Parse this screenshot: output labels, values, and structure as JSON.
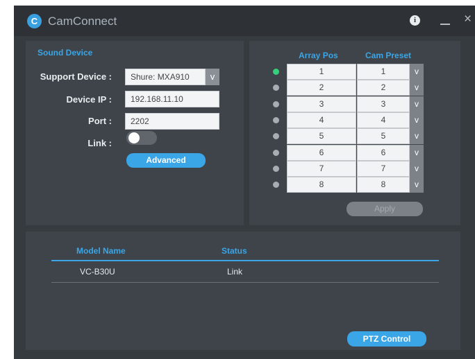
{
  "app": {
    "title": "CamConnect",
    "logo_letter": "C"
  },
  "window_controls": {
    "info": "i",
    "minimize": "",
    "close": "×"
  },
  "sound_device": {
    "section_title": "Sound Device",
    "support_device_label": "Support Device :",
    "support_device_value": "Shure: MXA910",
    "device_ip_label": "Device IP :",
    "device_ip_value": "192.168.11.10",
    "port_label": "Port :",
    "port_value": "2202",
    "link_label": "Link :",
    "link_on": false,
    "advanced_button": "Advanced"
  },
  "mapping": {
    "array_pos_header": "Array Pos",
    "cam_preset_header": "Cam Preset",
    "rows": [
      {
        "array_pos": "1",
        "cam_preset": "1",
        "active": true
      },
      {
        "array_pos": "2",
        "cam_preset": "2",
        "active": false
      },
      {
        "array_pos": "3",
        "cam_preset": "3",
        "active": false
      },
      {
        "array_pos": "4",
        "cam_preset": "4",
        "active": false
      },
      {
        "array_pos": "5",
        "cam_preset": "5",
        "active": false
      },
      {
        "array_pos": "6",
        "cam_preset": "6",
        "active": false
      },
      {
        "array_pos": "7",
        "cam_preset": "7",
        "active": false
      },
      {
        "array_pos": "8",
        "cam_preset": "8",
        "active": false
      }
    ],
    "apply_button": "Apply",
    "dropdown_glyph": "v"
  },
  "camera_table": {
    "headers": {
      "model_name": "Model Name",
      "status": "Status"
    },
    "rows": [
      {
        "model_name": "VC-B30U",
        "status": "Link"
      }
    ],
    "ptz_button": "PTZ Control"
  },
  "colors": {
    "accent": "#3aa6e8",
    "window_bg": "#363b40",
    "panel_bg": "#3e4449",
    "active_dot": "#35d07a",
    "inactive_dot": "#a7adb2"
  }
}
